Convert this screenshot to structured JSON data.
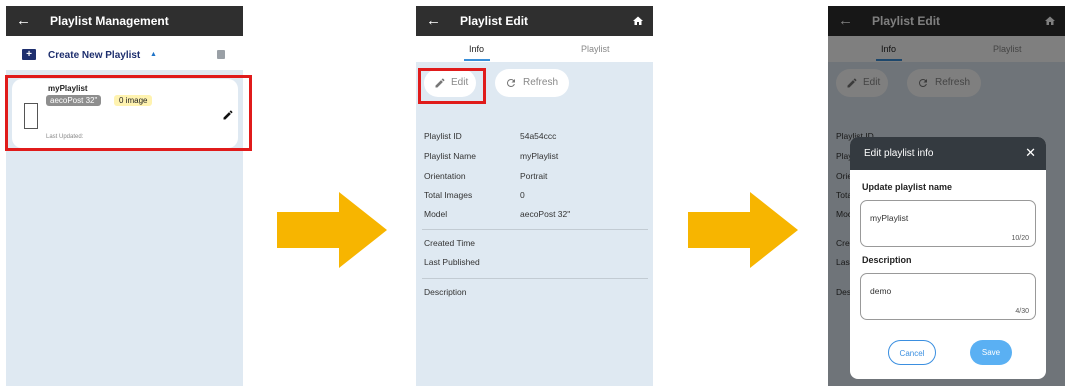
{
  "colors": {
    "appbar": "#2f2f2f",
    "panel_bg": "#dfe9f2",
    "highlight_red": "#e01b1b",
    "arrow": "#f7b500",
    "accent_blue": "#3b8fe0",
    "save_blue": "#5ab0f3"
  },
  "panel1": {
    "back_icon": "arrow-left-icon",
    "title": "Playlist Management",
    "create_label": "Create New Playlist",
    "caret": "▲",
    "card": {
      "name": "myPlaylist",
      "model_tag": "aecoPost 32\"",
      "image_tag": "0 image",
      "last_updated": "Last Updated:"
    }
  },
  "panel2": {
    "title": "Playlist Edit",
    "tabs": [
      "Info",
      "Playlist"
    ],
    "edit_label": "Edit",
    "refresh_label": "Refresh",
    "rows": [
      {
        "label": "Playlist ID",
        "value": "54a54ccc"
      },
      {
        "label": "Playlist Name",
        "value": "myPlaylist"
      },
      {
        "label": "Orientation",
        "value": "Portrait"
      },
      {
        "label": "Total Images",
        "value": "0"
      },
      {
        "label": "Model",
        "value": "aecoPost 32\""
      }
    ],
    "extra_rows": [
      "Created Time",
      "Last Published"
    ],
    "description_label": "Description"
  },
  "panel3": {
    "title": "Playlist Edit",
    "tabs": [
      "Info",
      "Playlist"
    ],
    "edit_label": "Edit",
    "refresh_label": "Refresh",
    "bg_fragments": [
      "Playlist ID",
      "Play",
      "Orie",
      "Tota",
      "Moc",
      "Crea",
      "Last",
      "Des"
    ],
    "dialog": {
      "title": "Edit playlist info",
      "close": "✕",
      "name_label": "Update playlist name",
      "name_value": "myPlaylist",
      "name_count": "10/20",
      "desc_label": "Description",
      "desc_value": "demo",
      "desc_count": "4/30",
      "cancel_label": "Cancel",
      "save_label": "Save"
    }
  }
}
